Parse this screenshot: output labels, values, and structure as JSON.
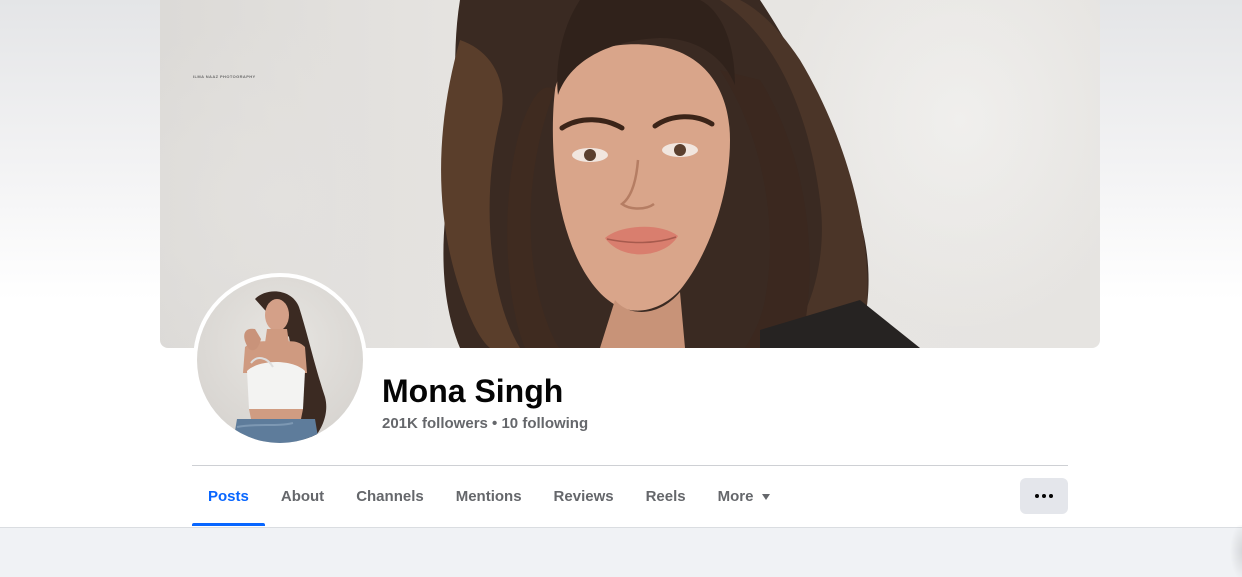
{
  "cover": {
    "watermark": "ILMA NAAZ PHOTOGRAPHY",
    "alt": "cover-photo"
  },
  "profile": {
    "name": "Mona Singh",
    "followers": "201K followers",
    "separator": " • ",
    "following": "10 following"
  },
  "tabs": [
    {
      "label": "Posts",
      "active": true
    },
    {
      "label": "About",
      "active": false
    },
    {
      "label": "Channels",
      "active": false
    },
    {
      "label": "Mentions",
      "active": false
    },
    {
      "label": "Reviews",
      "active": false
    },
    {
      "label": "Reels",
      "active": false
    },
    {
      "label": "More",
      "active": false
    }
  ],
  "actions": {
    "more_options_icon": "ellipsis-icon"
  },
  "colors": {
    "accent": "#0866ff",
    "secondary_text": "#65676b",
    "primary_text": "#050505",
    "button_bg": "#e4e6eb",
    "page_bg": "#f0f2f5"
  }
}
